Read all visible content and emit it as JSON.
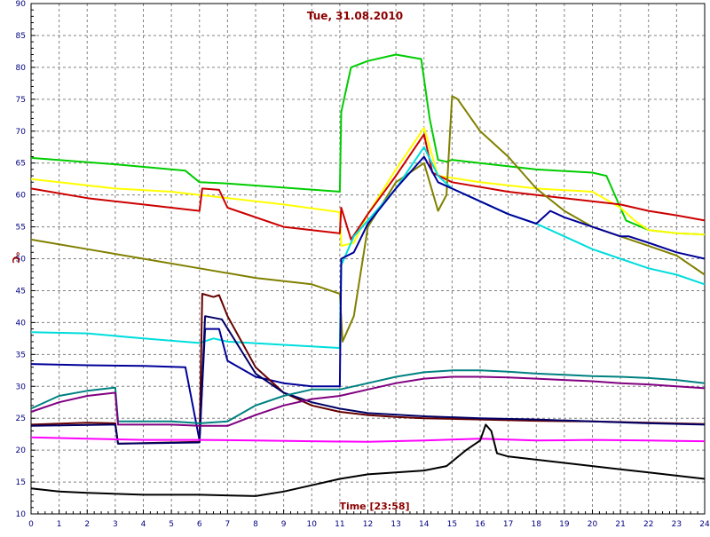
{
  "chart_data": {
    "type": "line",
    "title": "Tue, 31.08.2010",
    "xlabel": "Time [23:58]",
    "ylabel": "°C",
    "xlim": [
      0,
      24
    ],
    "ylim": [
      10,
      90
    ],
    "xticks": [
      0,
      1,
      2,
      3,
      4,
      5,
      6,
      7,
      8,
      9,
      10,
      11,
      12,
      13,
      14,
      15,
      16,
      17,
      18,
      19,
      20,
      21,
      22,
      23,
      24
    ],
    "yticks": [
      10,
      15,
      20,
      25,
      30,
      35,
      40,
      45,
      50,
      55,
      60,
      65,
      70,
      75,
      80,
      85,
      90
    ],
    "grid": true,
    "series": [
      {
        "color": "#00cc00",
        "x": [
          0,
          3,
          5.5,
          6,
          7,
          11,
          11.05,
          11.4,
          12,
          13,
          13.9,
          14.2,
          14.5,
          14.8,
          15,
          16,
          18,
          20,
          20.5,
          21.2,
          22,
          23,
          24
        ],
        "y": [
          65.8,
          64.8,
          63.8,
          62,
          61.8,
          60.5,
          73,
          80,
          81,
          82,
          81.3,
          72,
          65.5,
          65.2,
          65.5,
          65,
          64,
          63.5,
          63,
          56,
          54.5,
          54,
          53.8
        ]
      },
      {
        "color": "#ffff00",
        "x": [
          0,
          1,
          3,
          5,
          6,
          9,
          11,
          11.05,
          11.5,
          12,
          13,
          14,
          14.5,
          16,
          18,
          20,
          21,
          21.5,
          22,
          23,
          24
        ],
        "y": [
          62.5,
          62,
          61,
          60.5,
          60,
          58.5,
          57.3,
          52,
          52.5,
          57,
          64,
          70.5,
          63,
          62,
          61,
          60.5,
          58,
          56,
          54.5,
          54,
          53.8
        ]
      },
      {
        "color": "#cc0000",
        "x": [
          0,
          2,
          4,
          6,
          6.1,
          6.7,
          7,
          9,
          11,
          11.05,
          11.4,
          12,
          13,
          14,
          14.3,
          15,
          17,
          19,
          21,
          22,
          23,
          24
        ],
        "y": [
          61,
          59.5,
          58.5,
          57.5,
          61,
          60.8,
          58,
          55,
          54,
          58,
          53,
          57,
          63,
          69.5,
          63.5,
          62,
          60.5,
          59.5,
          58.5,
          57.5,
          56.8,
          56
        ]
      },
      {
        "color": "#808000",
        "x": [
          0,
          2,
          4,
          6,
          8,
          10,
          11,
          11.1,
          11.5,
          12,
          13,
          14,
          14.5,
          14.8,
          15,
          15.2,
          16,
          17,
          18,
          19,
          20,
          21,
          22,
          23,
          24
        ],
        "y": [
          53,
          51.5,
          50,
          48.5,
          47,
          46,
          44.5,
          37,
          41,
          55,
          62,
          65,
          57.5,
          60,
          75.5,
          75,
          70,
          66,
          61,
          57.5,
          55,
          53.5,
          52,
          50.5,
          47.5
        ]
      },
      {
        "color": "#00dddd",
        "x": [
          0,
          2,
          4,
          6,
          6.5,
          7,
          9,
          11,
          11.05,
          11.5,
          12,
          13,
          14,
          14.5,
          15,
          16,
          17,
          18,
          19,
          20,
          21,
          22,
          23,
          24
        ],
        "y": [
          38.5,
          38.3,
          37.5,
          36.8,
          37.5,
          37,
          36.5,
          36,
          49,
          53.5,
          56,
          61,
          67.5,
          63,
          61,
          59,
          57,
          55.5,
          53.5,
          51.5,
          50,
          48.5,
          47.5,
          46
        ]
      },
      {
        "color": "#000099",
        "x": [
          0,
          2,
          4,
          5.5,
          6,
          6.2,
          6.7,
          7,
          8,
          9,
          10,
          11,
          11.05,
          11.5,
          12,
          13,
          14,
          14.5,
          16,
          17,
          18,
          18.5,
          19,
          20,
          21,
          21.3,
          22,
          23,
          24
        ],
        "y": [
          33.5,
          33.3,
          33.2,
          33,
          21.5,
          39,
          39,
          34,
          31.5,
          30.5,
          30,
          30,
          50,
          51,
          55.5,
          61,
          66,
          62,
          59,
          57,
          55.5,
          57.5,
          56.5,
          55,
          53.5,
          53.5,
          52.5,
          51,
          50
        ]
      },
      {
        "color": "#660000",
        "x": [
          0,
          2,
          3,
          3.1,
          5,
          6,
          6.1,
          6.5,
          6.7,
          7,
          8,
          9,
          10,
          11,
          12,
          13,
          14,
          16,
          18,
          20,
          22,
          24
        ],
        "y": [
          24,
          24.3,
          24.2,
          21,
          21.2,
          21.3,
          44.5,
          44,
          44.3,
          41,
          33,
          29,
          27,
          26,
          25.5,
          25.2,
          25,
          24.8,
          24.6,
          24.5,
          24.3,
          24.1
        ]
      },
      {
        "color": "#000066",
        "x": [
          0,
          3,
          3.1,
          6,
          6.2,
          6.8,
          8,
          9,
          10,
          11,
          12,
          14,
          16,
          18,
          20,
          22,
          24
        ],
        "y": [
          23.8,
          24,
          21,
          21.2,
          41,
          40.5,
          32,
          29,
          27.5,
          26.5,
          25.8,
          25.3,
          25,
          24.8,
          24.5,
          24.2,
          24
        ]
      },
      {
        "color": "#008080",
        "x": [
          0,
          1,
          2,
          3,
          3.1,
          5,
          6,
          7,
          8,
          9,
          10,
          11,
          12,
          13,
          14,
          15,
          16,
          17,
          18,
          19,
          20,
          21,
          22,
          23,
          24
        ],
        "y": [
          26.5,
          28.5,
          29.3,
          29.8,
          24.5,
          24.5,
          24.2,
          24.5,
          27,
          28.5,
          29.5,
          29.5,
          30.5,
          31.5,
          32.2,
          32.5,
          32.5,
          32.3,
          32,
          31.8,
          31.6,
          31.5,
          31.3,
          31,
          30.5
        ]
      },
      {
        "color": "#800080",
        "x": [
          0,
          1,
          2,
          3,
          3.1,
          5,
          6,
          7,
          8,
          9,
          10,
          11,
          12,
          13,
          14,
          15,
          16,
          17,
          18,
          19,
          20,
          21,
          22,
          23,
          24
        ],
        "y": [
          26,
          27.5,
          28.5,
          29,
          24,
          24,
          23.8,
          23.8,
          25.5,
          27,
          28,
          28.5,
          29.5,
          30.5,
          31.2,
          31.5,
          31.5,
          31.4,
          31.2,
          31,
          30.8,
          30.5,
          30.3,
          30,
          29.7
        ]
      },
      {
        "color": "#ff00ff",
        "x": [
          0,
          2,
          4,
          6,
          8,
          10,
          12,
          14,
          16,
          18,
          20,
          22,
          24
        ],
        "y": [
          22,
          21.8,
          21.6,
          21.6,
          21.5,
          21.4,
          21.3,
          21.5,
          21.8,
          21.5,
          21.6,
          21.5,
          21.4
        ]
      },
      {
        "color": "#000000",
        "x": [
          0,
          1,
          2,
          4,
          6,
          8,
          9,
          10,
          11,
          12,
          13,
          14,
          14.8,
          15.5,
          16,
          16.2,
          16.4,
          16.6,
          17,
          18,
          19,
          20,
          21,
          22,
          23,
          24
        ],
        "y": [
          14,
          13.5,
          13.3,
          13,
          13,
          12.8,
          13.5,
          14.5,
          15.5,
          16.2,
          16.5,
          16.8,
          17.5,
          20,
          21.5,
          24,
          23,
          19.5,
          19,
          18.5,
          18,
          17.5,
          17,
          16.5,
          16,
          15.5
        ]
      }
    ]
  }
}
